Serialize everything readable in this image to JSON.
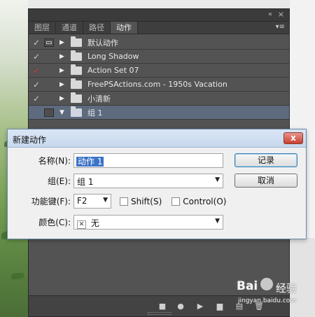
{
  "panel": {
    "tabs": [
      "图层",
      "通道",
      "路径",
      "动作"
    ],
    "active_tab": 3,
    "actions": [
      {
        "name": "默认动作",
        "check_color": "normal",
        "folder": "closed"
      },
      {
        "name": "Long Shadow",
        "check_color": "normal",
        "folder": "closed"
      },
      {
        "name": "Action Set 07",
        "check_color": "red",
        "folder": "closed"
      },
      {
        "name": "FreePSActions.com - 1950s Vacation",
        "check_color": "normal",
        "folder": "closed"
      },
      {
        "name": "小清新",
        "check_color": "normal",
        "folder": "closed"
      },
      {
        "name": "组 1",
        "check_color": "none",
        "folder": "open"
      }
    ],
    "icons": {
      "collapse": "«",
      "close": "×",
      "menu": "▾≡",
      "check": "✓",
      "stop": "■",
      "record": "●",
      "play": "▶",
      "new_set": "▆",
      "new_action": "▤",
      "delete": "🗑"
    }
  },
  "dialog": {
    "title": "新建动作",
    "close": "x",
    "name_label": "名称(N):",
    "name_value": "动作 1",
    "set_label": "组(E):",
    "set_value": "组 1",
    "fkey_label": "功能键(F):",
    "fkey_value": "F2",
    "shift_label": "Shift(S)",
    "control_label": "Control(O)",
    "color_label": "颜色(C):",
    "color_value": "无",
    "record_button": "记录",
    "cancel_button": "取消"
  },
  "watermark": {
    "logo": "Bai",
    "logo_tail": "经验",
    "url": "jingyan.baidu.com"
  },
  "colors": {
    "panel_bg": "#535353",
    "selected_row": "#5e6a7d",
    "red_check": "#dd3333",
    "dialog_title": "#c7d8ee"
  }
}
